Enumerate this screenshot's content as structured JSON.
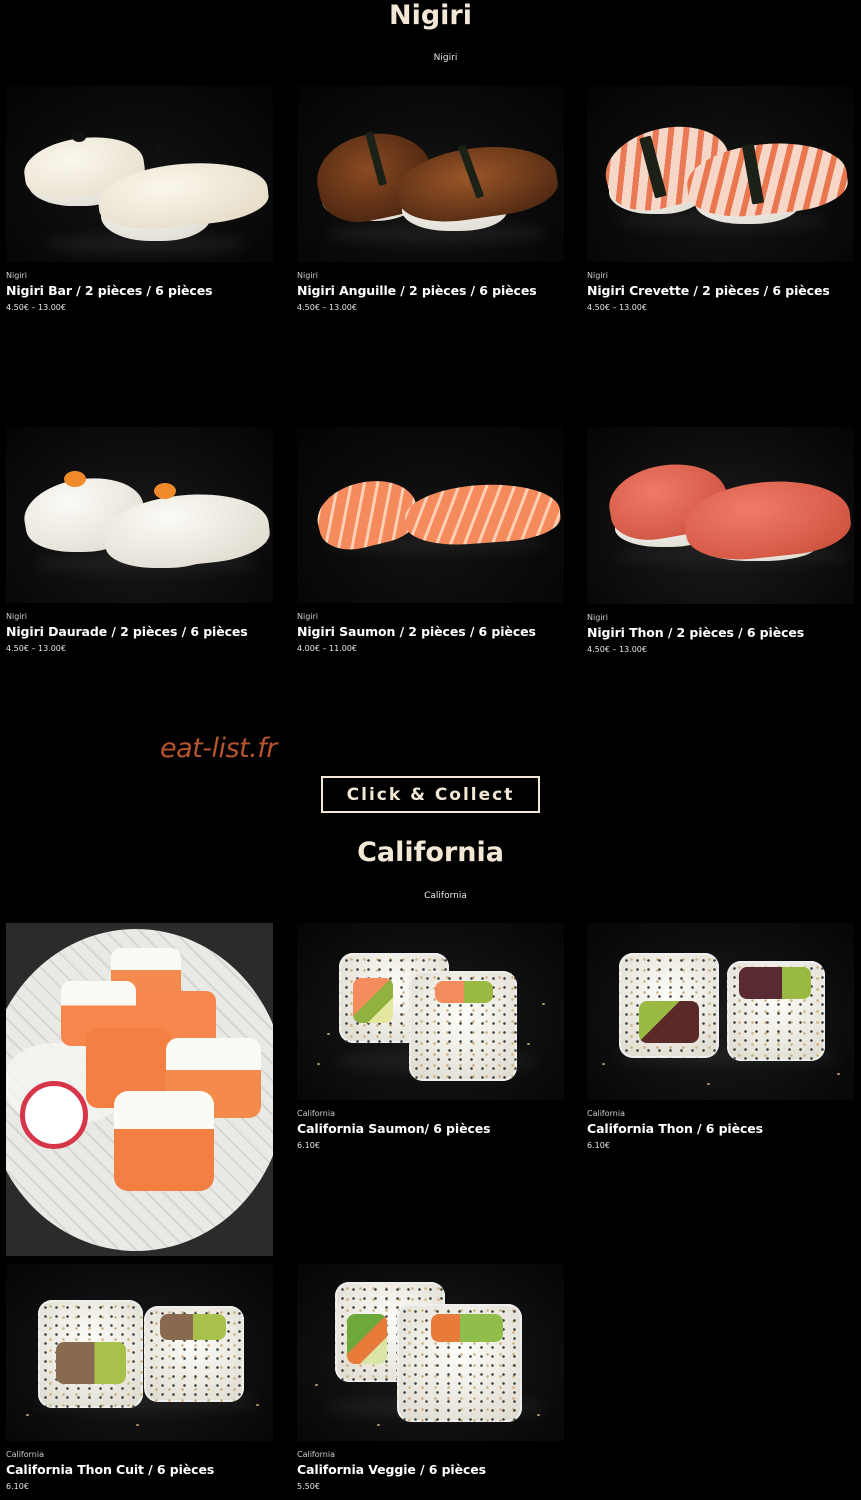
{
  "nigiri": {
    "title": "Nigiri",
    "subtitle": "Nigiri",
    "products": [
      {
        "category": "Nigiri",
        "name": "Nigiri Bar / 2 pièces / 6 pièces",
        "price": "4.50€ – 13.00€",
        "image": "nigiri-bar-image"
      },
      {
        "category": "Nigiri",
        "name": "Nigiri Anguille / 2 pièces / 6 pièces",
        "price": "4.50€ – 13.00€",
        "image": "nigiri-anguille-image"
      },
      {
        "category": "Nigiri",
        "name": "Nigiri Crevette / 2 pièces / 6 pièces",
        "price": "4.50€ – 13.00€",
        "image": "nigiri-crevette-image"
      },
      {
        "category": "Nigiri",
        "name": "Nigiri Daurade / 2 pièces / 6 pièces",
        "price": "4.50€ – 13.00€",
        "image": "nigiri-daurade-image"
      },
      {
        "category": "Nigiri",
        "name": "Nigiri Saumon / 2 pièces / 6 pièces",
        "price": "4.00€ – 11.00€",
        "image": "nigiri-saumon-image"
      },
      {
        "category": "Nigiri",
        "name": "Nigiri Thon / 2 pièces / 6 pièces",
        "price": "4.50€ – 13.00€",
        "image": "nigiri-thon-image"
      }
    ]
  },
  "watermark": "eat-list.fr",
  "cta": {
    "label": "Click & Collect"
  },
  "california": {
    "title": "California",
    "subtitle": "California",
    "products": [
      {
        "category": "California",
        "name": "California Saumon/ 6 pièces",
        "price": "6.10€",
        "image": "california-saumon-image"
      },
      {
        "category": "California",
        "name": "California Thon / 6 pièces",
        "price": "6.10€",
        "image": "california-thon-image"
      },
      {
        "category": "California",
        "name": "California Thon Cuit / 6 pièces",
        "price": "6.10€",
        "image": "california-thon-cuit-image"
      },
      {
        "category": "California",
        "name": "California Veggie / 6 pièces",
        "price": "5.50€",
        "image": "california-veggie-image"
      }
    ]
  },
  "colors": {
    "background": "#000000",
    "heading": "#f2e8d5",
    "watermark": "#b5552f"
  }
}
